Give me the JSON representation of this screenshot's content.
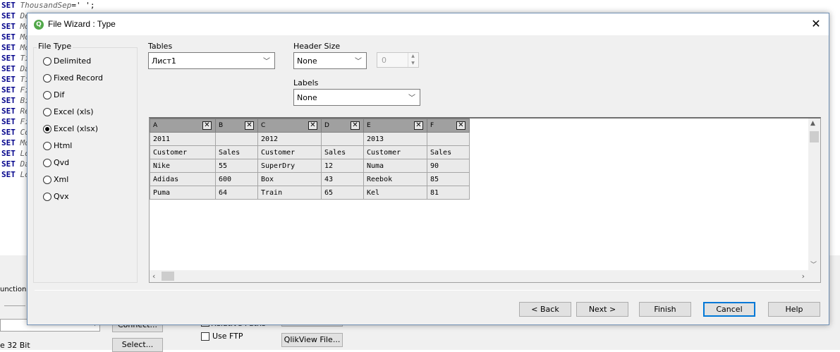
{
  "editor": {
    "lines": [
      {
        "kw": "SET",
        "var": "ThousandSep",
        "rest": "=' ';"
      },
      {
        "kw": "SET",
        "var": "DecimalSep",
        "rest": ""
      },
      {
        "kw": "SET",
        "var": "Mo",
        "rest": ""
      },
      {
        "kw": "SET",
        "var": "Mo",
        "rest": ""
      },
      {
        "kw": "SET",
        "var": "Mo",
        "rest": ""
      },
      {
        "kw": "SET",
        "var": "Ti",
        "rest": ""
      },
      {
        "kw": "SET",
        "var": "Da",
        "rest": ""
      },
      {
        "kw": "SET",
        "var": "Ti",
        "rest": ""
      },
      {
        "kw": "SET",
        "var": "Fi",
        "rest": ""
      },
      {
        "kw": "SET",
        "var": "Bi",
        "rest": ""
      },
      {
        "kw": "SET",
        "var": "Re",
        "rest": ""
      },
      {
        "kw": "SET",
        "var": "Fi",
        "rest": ""
      },
      {
        "kw": "SET",
        "var": "Co",
        "rest": ""
      },
      {
        "kw": "SET",
        "var": "Mo",
        "rest": ""
      },
      {
        "kw": "SET",
        "var": "Lo",
        "rest": ""
      },
      {
        "kw": "SET",
        "var": "Da",
        "rest": ""
      },
      {
        "kw": "SET",
        "var": "Lo",
        "rest": ""
      }
    ],
    "bottom": {
      "functions_tab": "unctions",
      "bit_label": "e 32 Bit",
      "connect_button": "Connect...",
      "select_button": "Select...",
      "relative_paths_label": "Relative Paths",
      "use_ftp_label": "Use FTP",
      "qlikview_file_button": "QlikView File..."
    }
  },
  "dialog": {
    "title": "File Wizard : Type",
    "icon_letter": "Q",
    "close_glyph": "✕",
    "file_type": {
      "caption": "File Type",
      "options": [
        "Delimited",
        "Fixed Record",
        "Dif",
        "Excel (xls)",
        "Excel (xlsx)",
        "Html",
        "Qvd",
        "Xml",
        "Qvx"
      ],
      "selected": "Excel (xlsx)"
    },
    "tables": {
      "label": "Tables",
      "value": "Лист1"
    },
    "header_size": {
      "label": "Header Size",
      "value": "None",
      "spin_value": "0"
    },
    "labels": {
      "label": "Labels",
      "value": "None"
    },
    "grid": {
      "columns": [
        "A",
        "B",
        "C",
        "D",
        "E",
        "F"
      ],
      "rows": [
        [
          "2011",
          "",
          "2012",
          "",
          "2013",
          ""
        ],
        [
          "Customer",
          "Sales",
          "Customer",
          "Sales",
          "Customer",
          "Sales"
        ],
        [
          "Nike",
          "55",
          "SuperDry",
          "12",
          "Numa",
          "90"
        ],
        [
          "Adidas",
          "600",
          "Box",
          "43",
          "Reebok",
          "85"
        ],
        [
          "Puma",
          "64",
          "Train",
          "65",
          "Kel",
          "81"
        ]
      ]
    },
    "buttons": {
      "back": "< Back",
      "next": "Next >",
      "finish": "Finish",
      "cancel": "Cancel",
      "help": "Help"
    }
  }
}
